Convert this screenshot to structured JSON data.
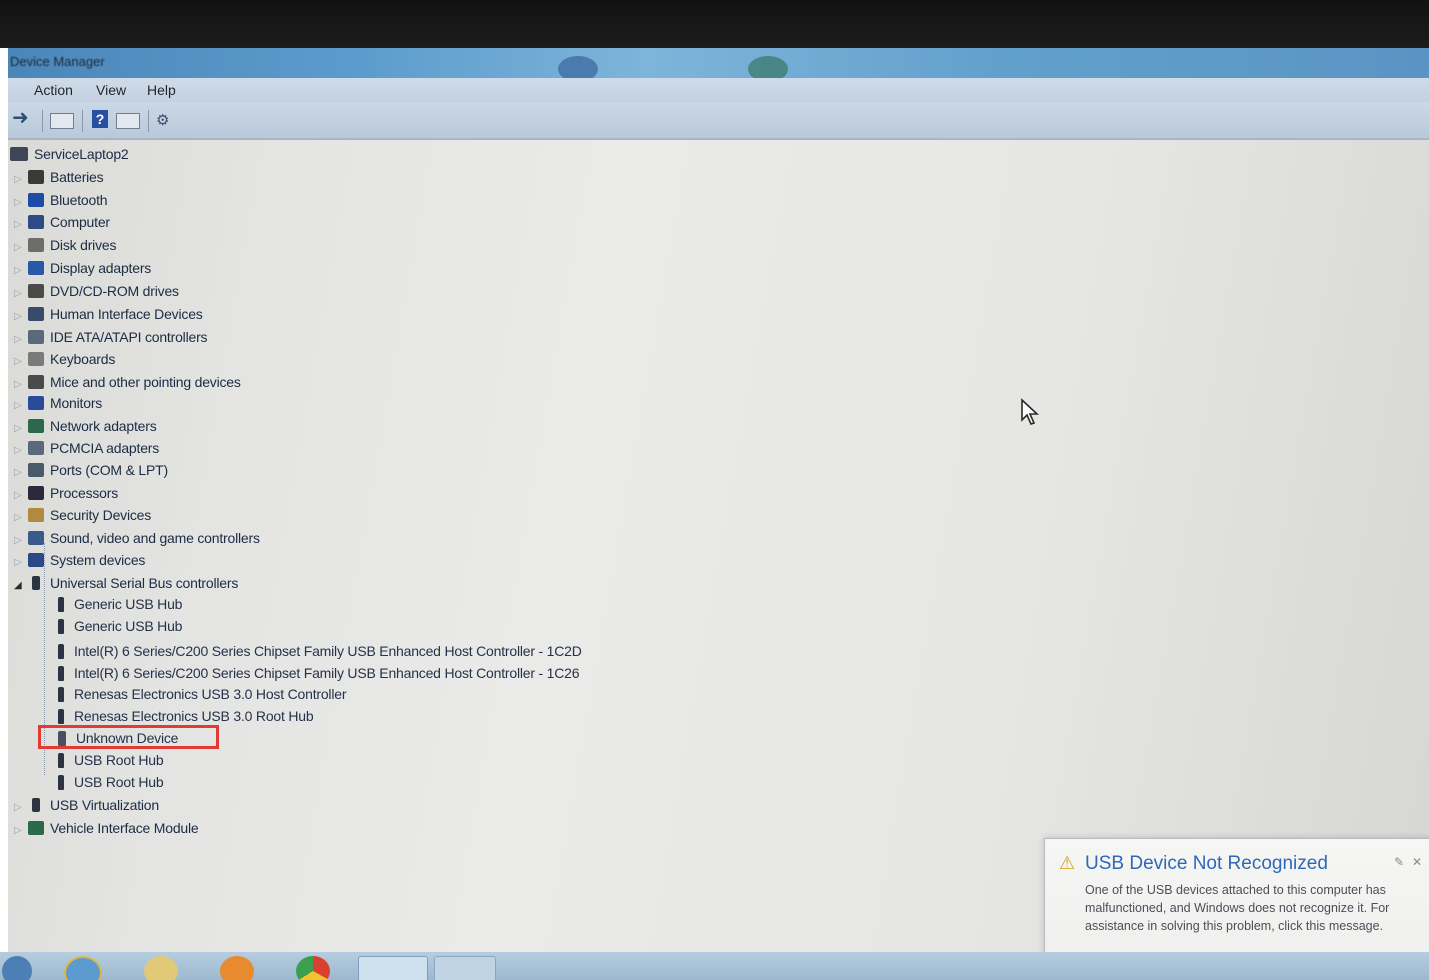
{
  "window": {
    "title": "Device Manager",
    "menu": [
      "Action",
      "View",
      "Help"
    ]
  },
  "tree": {
    "root": "ServiceLaptop2",
    "categories": [
      {
        "label": "Batteries",
        "icon": "battery-icon",
        "color": "#3a3a3a"
      },
      {
        "label": "Bluetooth",
        "icon": "bluetooth-icon",
        "color": "#1f4aa8"
      },
      {
        "label": "Computer",
        "icon": "computer-icon",
        "color": "#2c4a86"
      },
      {
        "label": "Disk drives",
        "icon": "disk-drive-icon",
        "color": "#6d6d6d"
      },
      {
        "label": "Display adapters",
        "icon": "display-adapter-icon",
        "color": "#2a58a8"
      },
      {
        "label": "DVD/CD-ROM drives",
        "icon": "dvd-drive-icon",
        "color": "#4a4a4a"
      },
      {
        "label": "Human Interface Devices",
        "icon": "hid-icon",
        "color": "#3a4a6a"
      },
      {
        "label": "IDE ATA/ATAPI controllers",
        "icon": "ide-controller-icon",
        "color": "#5a6a7a"
      },
      {
        "label": "Keyboards",
        "icon": "keyboard-icon",
        "color": "#7a7a7a"
      },
      {
        "label": "Mice and other pointing devices",
        "icon": "mouse-icon",
        "color": "#4a4a4a"
      },
      {
        "label": "Monitors",
        "icon": "monitor-icon",
        "color": "#2a4a9a"
      },
      {
        "label": "Network adapters",
        "icon": "network-adapter-icon",
        "color": "#2a6a4a"
      },
      {
        "label": "PCMCIA adapters",
        "icon": "pcmcia-icon",
        "color": "#5a6a7a"
      },
      {
        "label": "Ports (COM & LPT)",
        "icon": "port-icon",
        "color": "#4a5a6a"
      },
      {
        "label": "Processors",
        "icon": "processor-icon",
        "color": "#2a2a3a"
      },
      {
        "label": "Security Devices",
        "icon": "security-device-icon",
        "color": "#b08a40"
      },
      {
        "label": "Sound, video and game controllers",
        "icon": "sound-icon",
        "color": "#3a5a8a"
      },
      {
        "label": "System devices",
        "icon": "system-device-icon",
        "color": "#2a4a86"
      },
      {
        "label": "Universal Serial Bus controllers",
        "icon": "usb-icon",
        "color": "#2c3444",
        "expanded": true
      },
      {
        "label": "USB Virtualization",
        "icon": "usb-icon",
        "color": "#2c3444"
      },
      {
        "label": "Vehicle Interface Module",
        "icon": "network-adapter-icon",
        "color": "#2a6a4a"
      }
    ],
    "usb_children": [
      "Generic USB Hub",
      "Generic USB Hub",
      "Intel(R) 6 Series/C200 Series Chipset Family USB Enhanced Host Controller - 1C2D",
      "Intel(R) 6 Series/C200 Series Chipset Family USB Enhanced Host Controller - 1C26",
      "Renesas Electronics USB 3.0 Host Controller",
      "Renesas Electronics USB 3.0 Root Hub",
      "Unknown Device",
      "USB Root Hub",
      "USB Root Hub"
    ],
    "highlighted_item": "Unknown Device",
    "highlight_color": "#e43a34"
  },
  "notification": {
    "title": "USB Device Not Recognized",
    "body": "One of the USB devices attached to this computer has malfunctioned, and Windows does not recognize it. For assistance in solving this problem, click this message.",
    "icon": "warning-icon",
    "title_color": "#2f68b8"
  }
}
